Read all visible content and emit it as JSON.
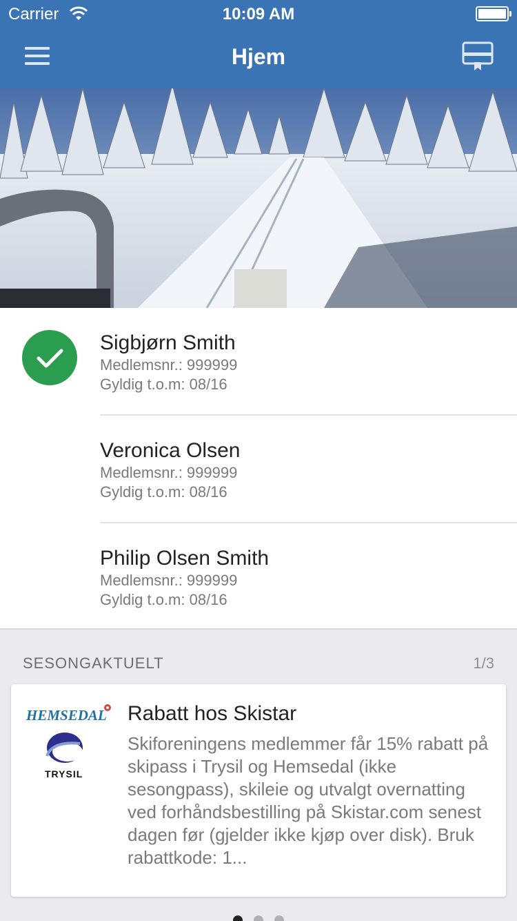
{
  "status_bar": {
    "carrier": "Carrier",
    "time": "10:09 AM"
  },
  "nav": {
    "title": "Hjem",
    "menu_icon": "hamburger-menu-icon",
    "card_icon": "membership-card-icon"
  },
  "members": [
    {
      "name": "Sigbjørn Smith",
      "member_no": "Medlemsnr.: 999999",
      "valid": "Gyldig t.o.m: 08/16",
      "active": true
    },
    {
      "name": "Veronica Olsen",
      "member_no": "Medlemsnr.: 999999",
      "valid": "Gyldig t.o.m: 08/16",
      "active": false
    },
    {
      "name": "Philip Olsen Smith",
      "member_no": "Medlemsnr.: 999999",
      "valid": "Gyldig t.o.m: 08/16",
      "active": false
    }
  ],
  "season": {
    "header": "SESONGAKTUELT",
    "count": "1/3",
    "card": {
      "title": "Rabatt hos Skistar",
      "body": "Skiforeningens medlemmer får 15% rabatt på skipass i Trysil og Hemsedal (ikke sesongpass), skileie og utvalgt overnatting ved forhåndsbestilling på Skistar.com senest dagen før (gjelder ikke kjøp over disk). Bruk rabattkode: 1...",
      "logo_text_top": "HEMSEDAL",
      "logo_text_bottom": "TRYSIL"
    }
  },
  "pagination": {
    "current": 1,
    "total": 3
  },
  "colors": {
    "nav_bg": "#3a74b5",
    "check_green": "#2a9d4e",
    "page_bg": "#ebebef"
  }
}
